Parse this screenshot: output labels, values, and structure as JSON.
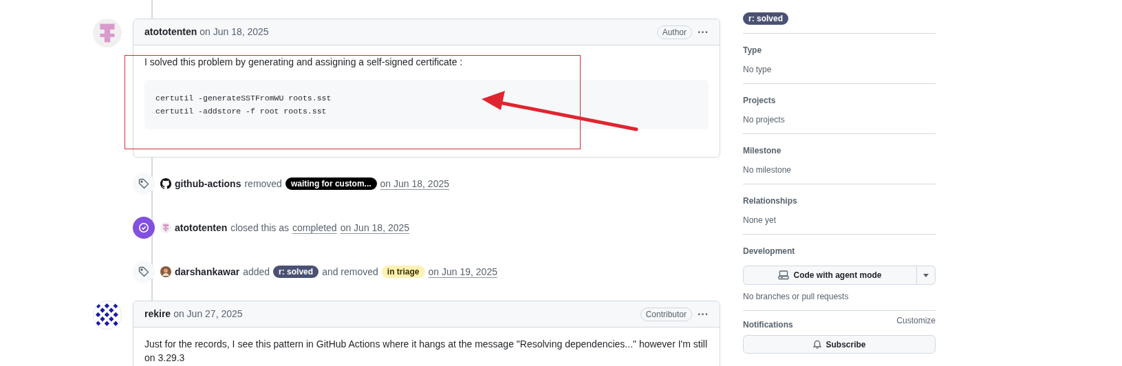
{
  "timeline": [
    {
      "kind": "comment",
      "author": "atototenten",
      "date": "on Jun 18, 2025",
      "badge": "Author",
      "menu": "···",
      "body": "I solved this problem by generating and assigning a self-signed certificate :",
      "code": [
        "certutil -generateSSTFromWU roots.sst",
        "certutil -addstore -f root roots.sst"
      ]
    },
    {
      "kind": "labeled",
      "parts": [
        {
          "kind": "user",
          "text": "github-actions"
        },
        {
          "kind": "text",
          "text": "removed"
        },
        {
          "kind": "label",
          "text": "waiting for custom...",
          "color": "#000000"
        },
        {
          "kind": "link",
          "text": "on Jun 18, 2025"
        }
      ]
    },
    {
      "kind": "closed",
      "parts": [
        {
          "kind": "user",
          "text": "atototenten"
        },
        {
          "kind": "text",
          "text": "closed this as"
        },
        {
          "kind": "link",
          "text": "completed"
        },
        {
          "kind": "link",
          "text": "on Jun 18, 2025"
        }
      ]
    },
    {
      "kind": "labeled",
      "parts": [
        {
          "kind": "user",
          "text": "darshankawar"
        },
        {
          "kind": "text",
          "text": "added"
        },
        {
          "kind": "label",
          "text": "r: solved",
          "color": "#4a5173"
        },
        {
          "kind": "text",
          "text": "and removed"
        },
        {
          "kind": "label",
          "text": "in triage",
          "color": "#fef2b4"
        },
        {
          "kind": "link",
          "text": "on Jun 19, 2025"
        }
      ]
    },
    {
      "kind": "comment",
      "author": "rekire",
      "date": "on Jun 27, 2025",
      "badge": "Contributor",
      "menu": "···",
      "body": "Just for the records, I see this pattern in GitHub Actions where it hangs at the message \"Resolving dependencies...\" however I'm still on 3.29.3"
    }
  ],
  "sidebar": [
    {
      "kind": "labels",
      "labels": [
        {
          "text": "r: solved",
          "color": "#4a5173"
        }
      ]
    },
    {
      "kind": "text",
      "title": "Type",
      "value": "No type"
    },
    {
      "kind": "text",
      "title": "Projects",
      "value": "No projects"
    },
    {
      "kind": "text",
      "title": "Milestone",
      "value": "No milestone"
    },
    {
      "kind": "text",
      "title": "Relationships",
      "value": "None yet"
    },
    {
      "kind": "development",
      "title": "Development",
      "button": "Code with agent mode",
      "value": "No branches or pull requests"
    },
    {
      "kind": "notifications",
      "title": "Notifications",
      "action": "Customize",
      "button": "Subscribe"
    }
  ]
}
